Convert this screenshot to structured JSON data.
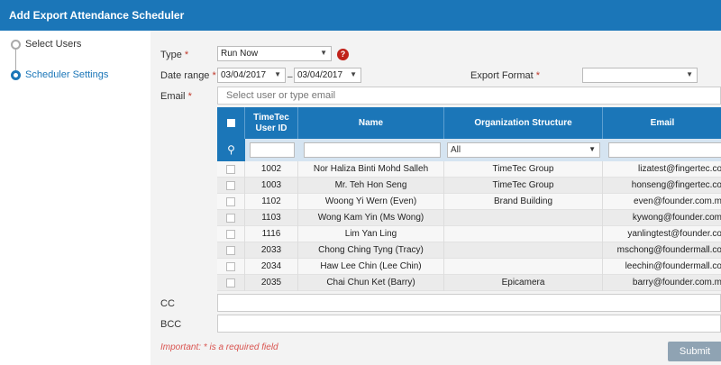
{
  "window": {
    "title": "Add Export Attendance Scheduler"
  },
  "steps": [
    {
      "label": "Select Users"
    },
    {
      "label": "Scheduler Settings"
    }
  ],
  "form": {
    "type_label": "Type",
    "type_value": "Run Now",
    "date_range_label": "Date range",
    "date_from": "03/04/2017",
    "date_sep": "–",
    "date_to": "03/04/2017",
    "export_format_label": "Export Format",
    "export_format_value": "",
    "email_label": "Email",
    "email_placeholder": "Select user or type email",
    "cc_label": "CC",
    "bcc_label": "BCC",
    "required_star": "*",
    "important_note": "Important: * is a required field",
    "submit_label": "Submit",
    "help_icon": "?"
  },
  "table": {
    "headers": {
      "user_id": "TimeTec User ID",
      "name": "Name",
      "org": "Organization Structure",
      "email": "Email"
    },
    "filter": {
      "search_icon": "🔍",
      "org_value": "All"
    },
    "rows": [
      {
        "id": "1002",
        "name": "Nor Haliza Binti Mohd Salleh",
        "org": "TimeTec Group",
        "email": "lizatest@fingertec.co"
      },
      {
        "id": "1003",
        "name": "Mr. Teh Hon Seng",
        "org": "TimeTec Group",
        "email": "honseng@fingertec.co"
      },
      {
        "id": "1102",
        "name": "Woong Yi Wern (Even)",
        "org": "Brand Building",
        "email": "even@founder.com.m"
      },
      {
        "id": "1103",
        "name": "Wong Kam Yin (Ms Wong)",
        "org": "",
        "email": "kywong@founder.com"
      },
      {
        "id": "1116",
        "name": "Lim Yan Ling",
        "org": "",
        "email": "yanlingtest@founder.co"
      },
      {
        "id": "2033",
        "name": "Chong Ching Tyng (Tracy)",
        "org": "",
        "email": "mschong@foundermall.co"
      },
      {
        "id": "2034",
        "name": "Haw Lee Chin (Lee Chin)",
        "org": "",
        "email": "leechin@foundermall.co"
      },
      {
        "id": "2035",
        "name": "Chai Chun Ket (Barry)",
        "org": "Epicamera",
        "email": "barry@founder.com.m"
      }
    ]
  },
  "colors": {
    "accent": "#1b76b8",
    "required": "#c0392b",
    "submit_bg": "#8fa3b3"
  }
}
